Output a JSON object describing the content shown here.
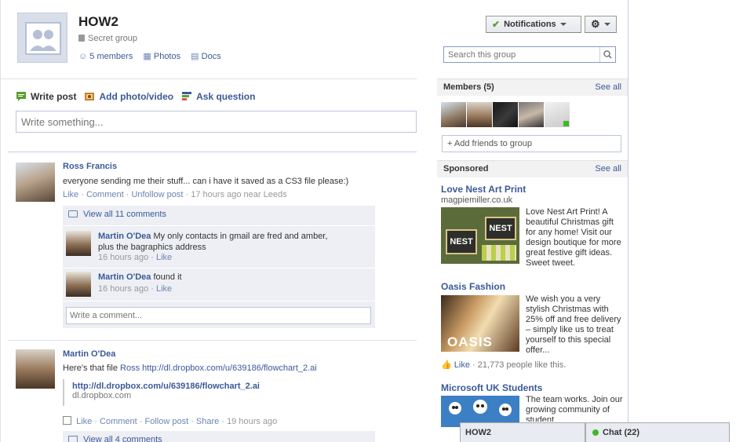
{
  "group": {
    "name": "HOW2",
    "privacy": "Secret group",
    "links": {
      "members": "5 members",
      "photos": "Photos",
      "docs": "Docs"
    }
  },
  "toolbar": {
    "notifications": "Notifications"
  },
  "search": {
    "placeholder": "Search this group"
  },
  "composer": {
    "tabs": {
      "write_post": "Write post",
      "add_photo": "Add photo/video",
      "ask_question": "Ask question"
    },
    "placeholder": "Write something..."
  },
  "stories": [
    {
      "author": "Ross Francis",
      "message": "everyone sending me their stuff... can i have it saved as a CS3 file please:)",
      "actions": {
        "like": "Like",
        "comment": "Comment",
        "unfollow": "Unfollow post",
        "time": "17 hours ago near Leeds"
      },
      "view_all": "View all 11 comments",
      "comments": [
        {
          "author": "Martin O'Dea",
          "text": "My only contacts in gmail are fred and amber,",
          "text2": "plus the bagraphics address",
          "time": "16 hours ago",
          "like": "Like"
        },
        {
          "author": "Martin O'Dea",
          "text": "found it",
          "time": "16 hours ago",
          "like": "Like"
        }
      ],
      "comment_placeholder": "Write a comment..."
    },
    {
      "author": "Martin O'Dea",
      "message": "Here's that file",
      "mention": "Ross",
      "url": "http://dl.dropbox.com/u/639186/flowchart_2.ai",
      "attachment": {
        "title": "http://dl.dropbox.com/u/639186/flowchart_2.ai",
        "domain": "dl.dropbox.com"
      },
      "actions": {
        "like": "Like",
        "comment": "Comment",
        "follow": "Follow post",
        "share": "Share",
        "time": "19 hours ago"
      },
      "view_all": "View all 4 comments"
    }
  ],
  "sidebar": {
    "members": {
      "title": "Members",
      "count": "(5)",
      "see_all": "See all",
      "add_friends": "+ Add friends to group"
    },
    "sponsored": {
      "title": "Sponsored",
      "see_all": "See all"
    },
    "ads": [
      {
        "title": "Love Nest Art Print",
        "domain": "magpiemiller.co.uk",
        "body": "Love Nest Art Print! A beautiful Christmas gift for any home! Visit our design boutique for more great festive gift ideas. Sweet tweet.",
        "img_text_1": "NEST",
        "img_text_2": "NEST"
      },
      {
        "title": "Oasis Fashion",
        "body": "We wish you a very stylish Christmas with 25% off and free delivery – simply like us to treat yourself to this special offer...",
        "img_text": "OASIS",
        "like": "Like",
        "like_count": "· 21,773 people like this."
      },
      {
        "title": "Microsoft UK Students",
        "body": "The team works. Join our growing community of student"
      }
    ]
  },
  "chatbar": {
    "group_tab": "HOW2",
    "chat_label": "Chat",
    "chat_count": "(22)"
  },
  "colors": {
    "link": "#3b5998",
    "online": "#42b72a",
    "check": "#5aa02c"
  }
}
